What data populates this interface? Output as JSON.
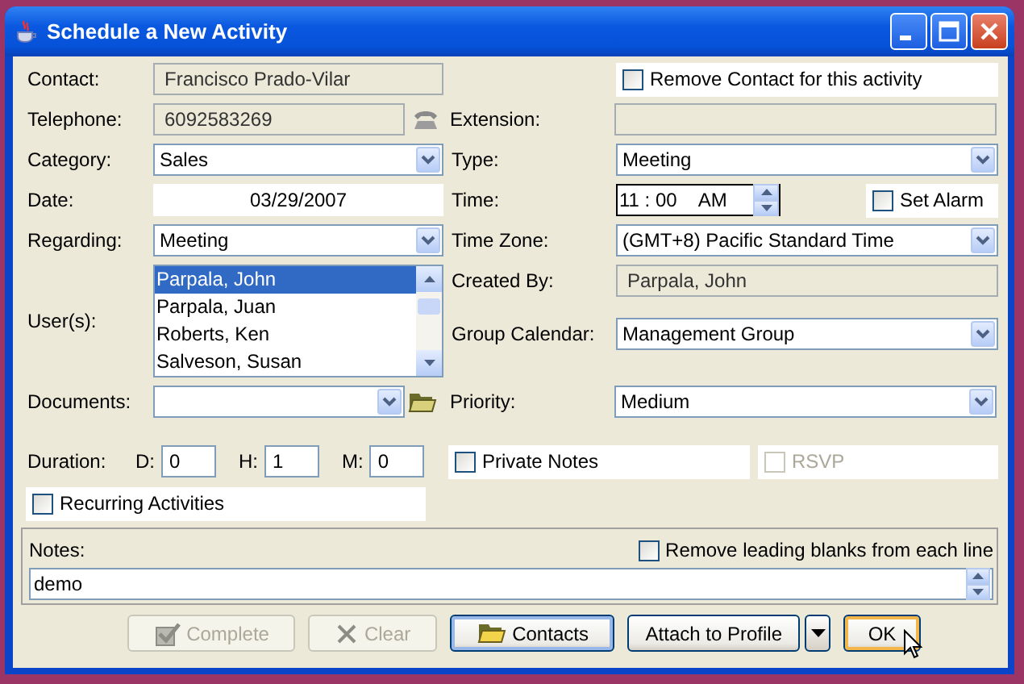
{
  "window": {
    "title": "Schedule a New Activity"
  },
  "contact": {
    "label": "Contact:",
    "value": "Francisco Prado-Vilar"
  },
  "remove_contact": {
    "label": "Remove Contact for this activity",
    "checked": false
  },
  "telephone": {
    "label": "Telephone:",
    "value": "6092583269"
  },
  "extension": {
    "label": "Extension:"
  },
  "category": {
    "label": "Category:",
    "value": "Sales"
  },
  "type": {
    "label": "Type:",
    "value": "Meeting"
  },
  "date": {
    "label": "Date:",
    "value": "03/29/2007"
  },
  "time": {
    "label": "Time:",
    "value": "11 : 00",
    "ampm": "AM"
  },
  "set_alarm": {
    "label": "Set Alarm",
    "checked": false
  },
  "regarding": {
    "label": "Regarding:",
    "value": "Meeting"
  },
  "time_zone": {
    "label": "Time Zone:",
    "value": "(GMT+8) Pacific Standard Time"
  },
  "users": {
    "label": "User(s):",
    "items": [
      {
        "name": "Parpala, John",
        "selected": true
      },
      {
        "name": "Parpala, Juan",
        "selected": false
      },
      {
        "name": "Roberts, Ken",
        "selected": false
      },
      {
        "name": "Salveson, Susan",
        "selected": false
      }
    ]
  },
  "created_by": {
    "label": "Created By:",
    "value": "Parpala, John"
  },
  "group_calendar": {
    "label": "Group Calendar:",
    "value": "Management Group"
  },
  "documents": {
    "label": "Documents:"
  },
  "priority": {
    "label": "Priority:",
    "value": "Medium"
  },
  "duration": {
    "label": "Duration:",
    "parts": [
      {
        "label": "D:",
        "value": "0"
      },
      {
        "label": "H:",
        "value": "1"
      },
      {
        "label": "M:",
        "value": "0"
      }
    ]
  },
  "private_notes": {
    "label": "Private Notes",
    "checked": false,
    "disabled": false
  },
  "rsvp": {
    "label": "RSVP",
    "checked": false,
    "disabled": true
  },
  "recurring": {
    "label": "Recurring Activities",
    "checked": false
  },
  "notes": {
    "label": "Notes:",
    "value": "demo",
    "remove_blanks": {
      "label": "Remove leading blanks from each line",
      "checked": false
    }
  },
  "buttons": [
    {
      "label": "Complete",
      "disabled": true,
      "focused": false,
      "hovered": false
    },
    {
      "label": "Clear",
      "disabled": true,
      "focused": false,
      "hovered": false
    },
    {
      "label": "Contacts",
      "disabled": false,
      "focused": true,
      "hovered": false
    },
    {
      "label": "Attach to Profile",
      "disabled": false,
      "focused": false,
      "hovered": false
    },
    {
      "label": "OK",
      "disabled": false,
      "focused": false,
      "hovered": true
    }
  ]
}
